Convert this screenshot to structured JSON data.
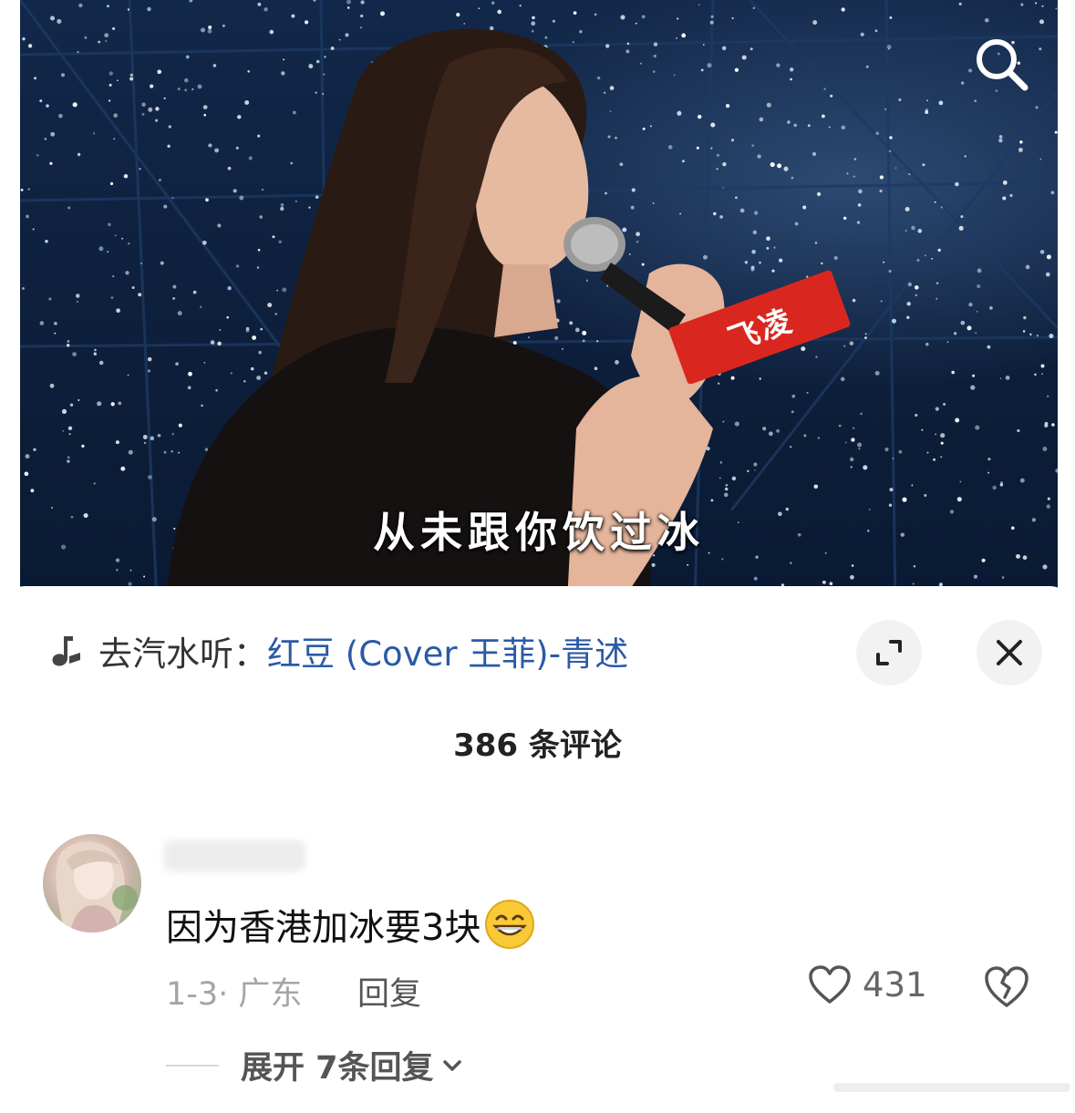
{
  "video": {
    "subtitle": "从未跟你饮过冰",
    "mic_label": "飞凌"
  },
  "music": {
    "prefix": "去汽水听：",
    "song": "红豆 (Cover 王菲)-青述"
  },
  "comments_header": {
    "count_text": "386 条评论"
  },
  "comment": {
    "text": "因为香港加冰要3块",
    "emoji": "grinning-face",
    "date_location": "1-3· 广东",
    "reply_label": "回复",
    "like_count": "431"
  },
  "expand": {
    "label": "展开 7条回复"
  },
  "icons": {
    "search": "search-icon",
    "expand": "expand-icon",
    "close": "close-icon",
    "note": "music-note-icon",
    "heart": "heart-icon",
    "broken_heart": "broken-heart-icon",
    "chevron": "chevron-down-icon"
  },
  "colors": {
    "song_link": "#2b5aa6",
    "mic_label_bg": "#d9271f"
  }
}
